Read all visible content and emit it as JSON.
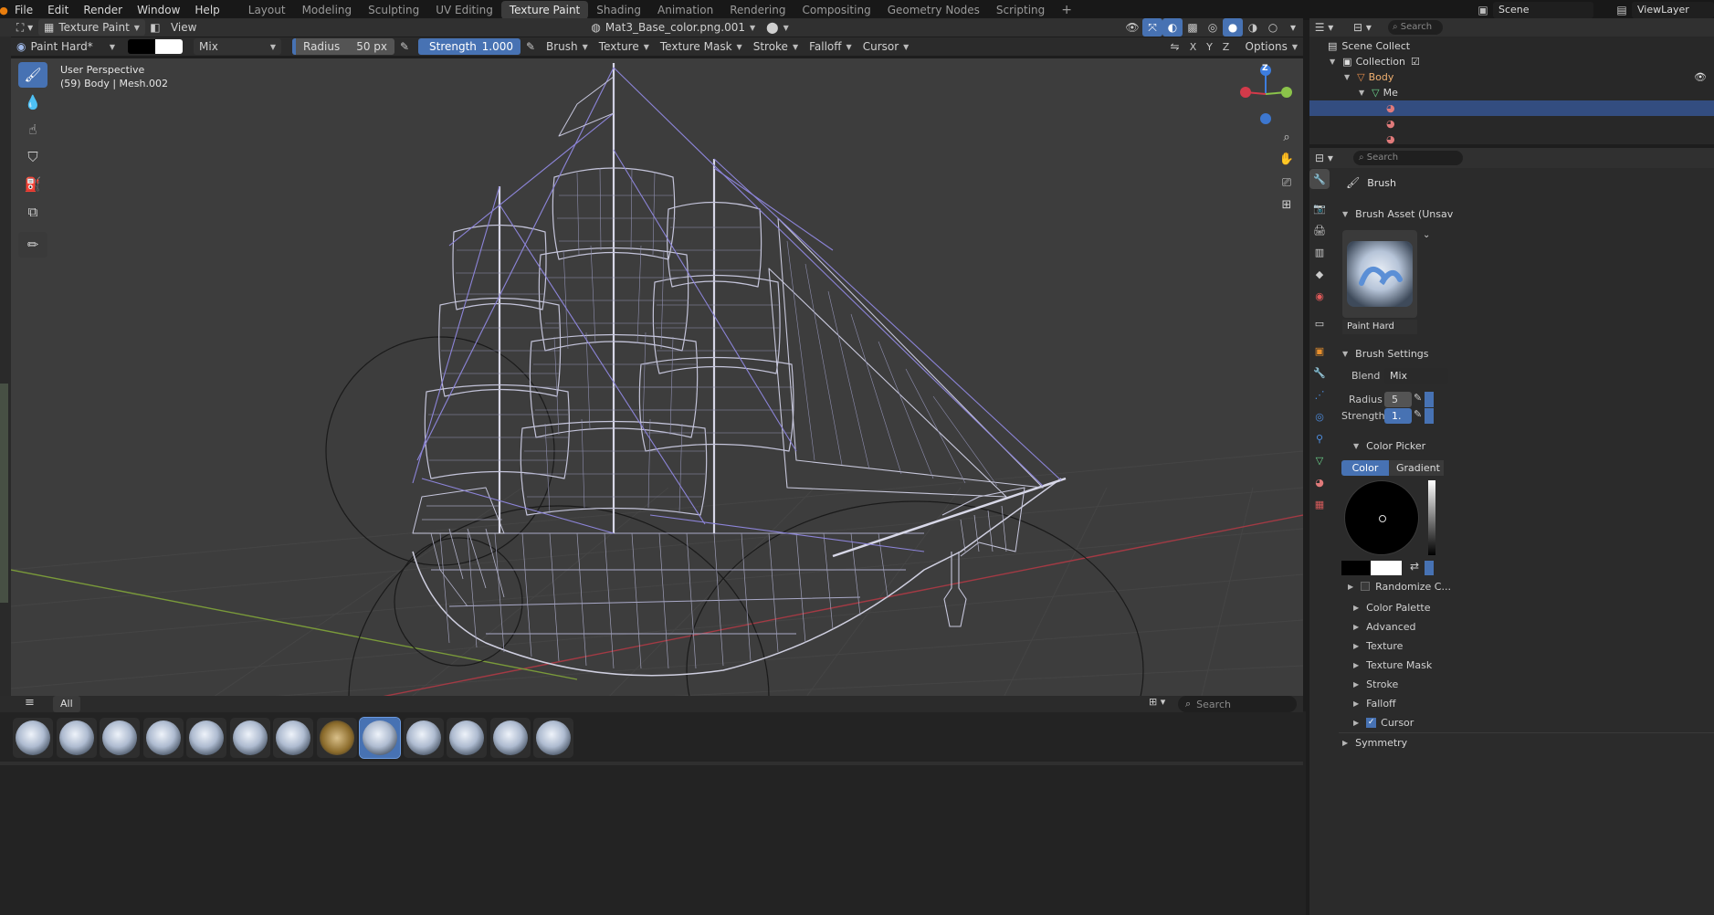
{
  "menubar": {
    "items": [
      "File",
      "Edit",
      "Render",
      "Window",
      "Help"
    ],
    "workspaces": [
      "Layout",
      "Modeling",
      "Sculpting",
      "UV Editing",
      "Texture Paint",
      "Shading",
      "Animation",
      "Rendering",
      "Compositing",
      "Geometry Nodes",
      "Scripting"
    ],
    "active_workspace": "Texture Paint",
    "add_tab": "+",
    "scene": "Scene",
    "view_layer": "ViewLayer"
  },
  "editor_header": {
    "mode": "Texture Paint",
    "view_menu": "View",
    "image_name": "Mat3_Base_color.png.001",
    "header_search_placeholder": "Search"
  },
  "tool_header": {
    "brush_name": "Paint Hard*",
    "blend": "Mix",
    "radius_label": "Radius",
    "radius_value": "50 px",
    "strength_label": "Strength",
    "strength_value": "1.000",
    "menus": [
      "Brush",
      "Texture",
      "Texture Mask",
      "Stroke",
      "Falloff",
      "Cursor"
    ],
    "axes": [
      "X",
      "Y",
      "Z"
    ],
    "options": "Options"
  },
  "viewport": {
    "perspective": "User Perspective",
    "object_info": "(59) Body | Mesh.002"
  },
  "gizmo": {
    "x": "X",
    "y": "Y",
    "z": "Z"
  },
  "toolbar_icons": [
    "brush-icon",
    "blur-drop-icon",
    "smear-icon",
    "clone-stamp-icon",
    "fill-bucket-icon",
    "mask-icon",
    "annotate-icon"
  ],
  "shelf": {
    "menu_icon": "≡",
    "catalog": "All",
    "search_placeholder": "Search",
    "brush_count": 13,
    "active_index": 8
  },
  "outliner": {
    "scene_collection": "Scene Collect",
    "collection": "Collection",
    "body": "Body",
    "mesh": "Me",
    "search_placeholder": "Search"
  },
  "properties": {
    "tab_title": "Brush",
    "brush_asset_header": "Brush Asset (Unsav",
    "brush_preview_name": "Paint Hard",
    "brush_settings_header": "Brush Settings",
    "blend_label": "Blend",
    "blend_value": "Mix",
    "radius_label": "Radius",
    "radius_value": "5",
    "strength_label": "Strength",
    "strength_value": "1.",
    "color_picker_header": "Color Picker",
    "color_tab": "Color",
    "gradient_tab": "Gradient",
    "randomize": "Randomize C...",
    "subpanels": [
      "Color Palette",
      "Advanced",
      "Texture",
      "Texture Mask",
      "Stroke",
      "Falloff",
      "Cursor"
    ],
    "cursor_checked": true,
    "symmetry": "Symmetry"
  },
  "colors": {
    "accent": "#4772b3",
    "viewport_bg": "#3d3d3d",
    "wire": "#d2d2e6",
    "wire_selected": "#8c84d8",
    "x_axis": "#d33a4a",
    "y_axis": "#8bc34a",
    "z_axis": "#3d7ddf"
  }
}
